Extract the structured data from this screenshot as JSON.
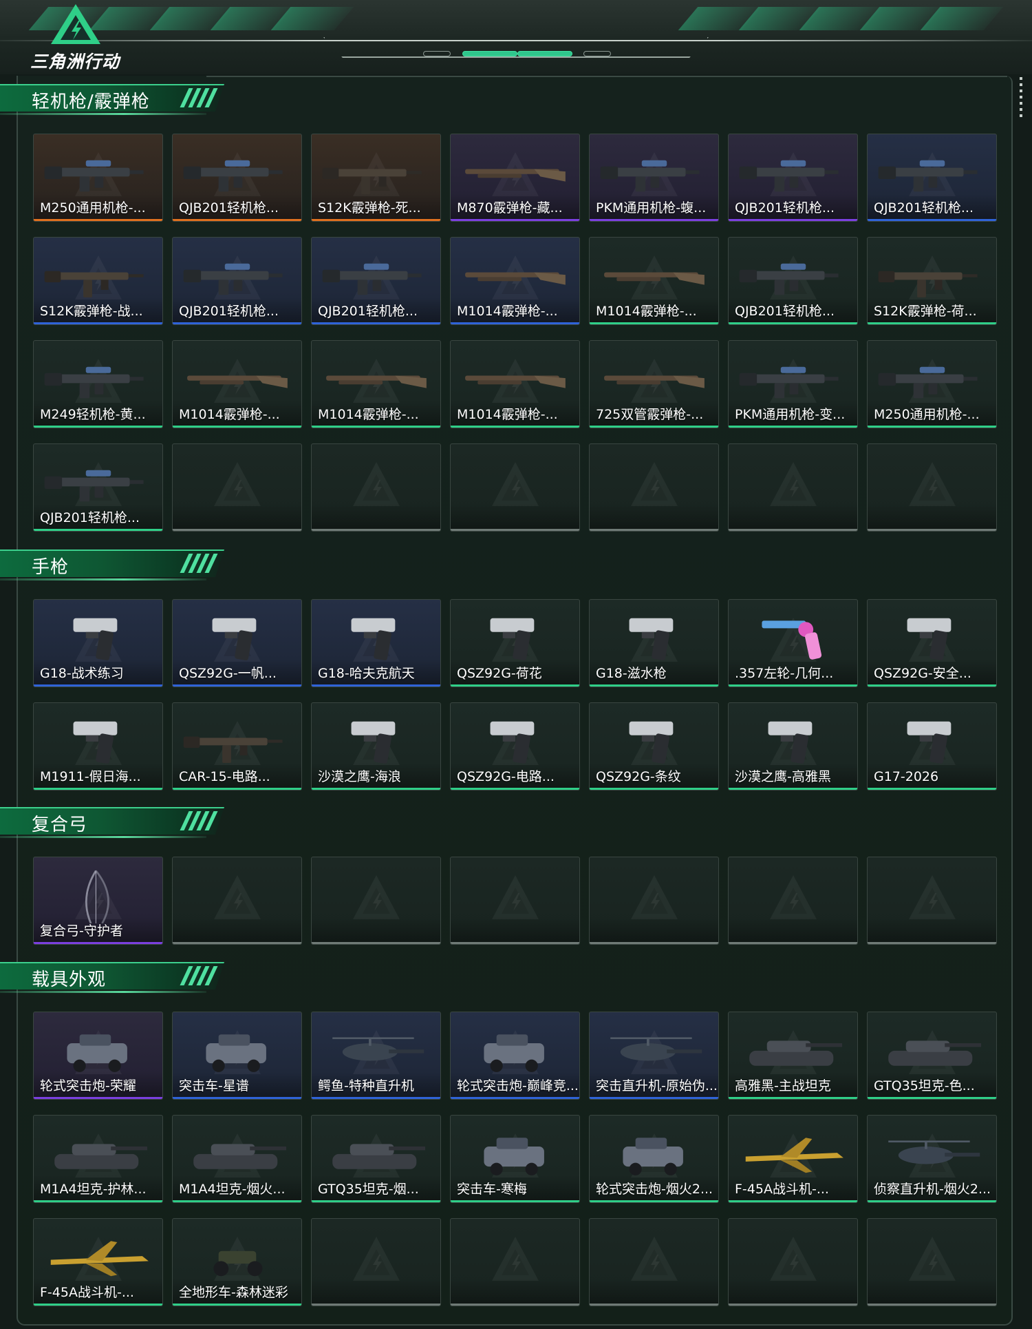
{
  "app": {
    "logo_text": "三角洲行动"
  },
  "colors": {
    "accent": "#2fcf88",
    "orange": "#e0701f",
    "purple": "#7b3fe0",
    "blue": "#2f63d8",
    "green": "#2fcf88",
    "empty": "#6f7a76"
  },
  "sections": [
    {
      "title": "轻机枪/霰弹枪",
      "items": [
        {
          "name": "M250通用机枪-...",
          "rarity": "orange",
          "art": "lmg"
        },
        {
          "name": "QJB201轻机枪...",
          "rarity": "orange",
          "art": "lmg"
        },
        {
          "name": "S12K霰弹枪-死...",
          "rarity": "orange",
          "art": "rifle"
        },
        {
          "name": "M870霰弹枪-藏...",
          "rarity": "purple",
          "art": "shotgun"
        },
        {
          "name": "PKM通用机枪-蝮...",
          "rarity": "purple",
          "art": "lmg"
        },
        {
          "name": "QJB201轻机枪...",
          "rarity": "purple",
          "art": "lmg"
        },
        {
          "name": "QJB201轻机枪...",
          "rarity": "blue",
          "art": "lmg"
        },
        {
          "name": "S12K霰弹枪-战...",
          "rarity": "blue",
          "art": "rifle"
        },
        {
          "name": "QJB201轻机枪...",
          "rarity": "blue",
          "art": "lmg"
        },
        {
          "name": "QJB201轻机枪...",
          "rarity": "blue",
          "art": "lmg"
        },
        {
          "name": "M1014霰弹枪-...",
          "rarity": "blue",
          "art": "shotgun"
        },
        {
          "name": "M1014霰弹枪-...",
          "rarity": "green",
          "art": "shotgun"
        },
        {
          "name": "QJB201轻机枪...",
          "rarity": "green",
          "art": "lmg"
        },
        {
          "name": "S12K霰弹枪-荷...",
          "rarity": "green",
          "art": "rifle"
        },
        {
          "name": "M249轻机枪-黄...",
          "rarity": "green",
          "art": "lmg"
        },
        {
          "name": "M1014霰弹枪-...",
          "rarity": "green",
          "art": "shotgun"
        },
        {
          "name": "M1014霰弹枪-...",
          "rarity": "green",
          "art": "shotgun"
        },
        {
          "name": "M1014霰弹枪-...",
          "rarity": "green",
          "art": "shotgun"
        },
        {
          "name": "725双管霰弹枪-...",
          "rarity": "green",
          "art": "shotgun"
        },
        {
          "name": "PKM通用机枪-变...",
          "rarity": "green",
          "art": "lmg"
        },
        {
          "name": "M250通用机枪-...",
          "rarity": "green",
          "art": "lmg"
        },
        {
          "name": "QJB201轻机枪...",
          "rarity": "green",
          "art": "lmg"
        },
        {
          "name": "",
          "rarity": "empty",
          "art": ""
        },
        {
          "name": "",
          "rarity": "empty",
          "art": ""
        },
        {
          "name": "",
          "rarity": "empty",
          "art": ""
        },
        {
          "name": "",
          "rarity": "empty",
          "art": ""
        },
        {
          "name": "",
          "rarity": "empty",
          "art": ""
        },
        {
          "name": "",
          "rarity": "empty",
          "art": ""
        }
      ]
    },
    {
      "title": "手枪",
      "items": [
        {
          "name": "G18-战术练习",
          "rarity": "blue",
          "art": "pistol"
        },
        {
          "name": "QSZ92G-一帆...",
          "rarity": "blue",
          "art": "pistol"
        },
        {
          "name": "G18-哈夫克航天",
          "rarity": "blue",
          "art": "pistol"
        },
        {
          "name": "QSZ92G-荷花",
          "rarity": "green",
          "art": "pistol"
        },
        {
          "name": "G18-滋水枪",
          "rarity": "green",
          "art": "pistol"
        },
        {
          "name": ".357左轮-几何...",
          "rarity": "green",
          "art": "revolver"
        },
        {
          "name": "QSZ92G-安全...",
          "rarity": "green",
          "art": "pistol"
        },
        {
          "name": "M1911-假日海...",
          "rarity": "green",
          "art": "pistol"
        },
        {
          "name": "CAR-15-电路...",
          "rarity": "green",
          "art": "rifle"
        },
        {
          "name": "沙漠之鹰-海浪",
          "rarity": "green",
          "art": "pistol"
        },
        {
          "name": "QSZ92G-电路...",
          "rarity": "green",
          "art": "pistol"
        },
        {
          "name": "QSZ92G-条纹",
          "rarity": "green",
          "art": "pistol"
        },
        {
          "name": "沙漠之鹰-高雅黑",
          "rarity": "green",
          "art": "pistol"
        },
        {
          "name": "G17-2026",
          "rarity": "green",
          "art": "pistol"
        }
      ]
    },
    {
      "title": "复合弓",
      "items": [
        {
          "name": "复合弓-守护者",
          "rarity": "purple",
          "art": "bow"
        },
        {
          "name": "",
          "rarity": "empty",
          "art": ""
        },
        {
          "name": "",
          "rarity": "empty",
          "art": ""
        },
        {
          "name": "",
          "rarity": "empty",
          "art": ""
        },
        {
          "name": "",
          "rarity": "empty",
          "art": ""
        },
        {
          "name": "",
          "rarity": "empty",
          "art": ""
        },
        {
          "name": "",
          "rarity": "empty",
          "art": ""
        }
      ]
    },
    {
      "title": "载具外观",
      "items": [
        {
          "name": "轮式突击炮-荣耀",
          "rarity": "purple",
          "art": "vehicle"
        },
        {
          "name": "突击车-星谱",
          "rarity": "blue",
          "art": "vehicle"
        },
        {
          "name": "鳄鱼-特种直升机",
          "rarity": "blue",
          "art": "heli"
        },
        {
          "name": "轮式突击炮-巅峰竞...",
          "rarity": "blue",
          "art": "vehicle"
        },
        {
          "name": "突击直升机-原始伪...",
          "rarity": "blue",
          "art": "heli"
        },
        {
          "name": "高雅黑-主战坦克",
          "rarity": "green",
          "art": "tank"
        },
        {
          "name": "GTQ35坦克-色...",
          "rarity": "green",
          "art": "tank"
        },
        {
          "name": "M1A4坦克-护林...",
          "rarity": "green",
          "art": "tank"
        },
        {
          "name": "M1A4坦克-烟火...",
          "rarity": "green",
          "art": "tank"
        },
        {
          "name": "GTQ35坦克-烟...",
          "rarity": "green",
          "art": "tank"
        },
        {
          "name": "突击车-寒梅",
          "rarity": "green",
          "art": "vehicle"
        },
        {
          "name": "轮式突击炮-烟火2...",
          "rarity": "green",
          "art": "vehicle"
        },
        {
          "name": "F-45A战斗机-...",
          "rarity": "green",
          "art": "jet"
        },
        {
          "name": "侦察直升机-烟火2...",
          "rarity": "green",
          "art": "heli"
        },
        {
          "name": "F-45A战斗机-...",
          "rarity": "green",
          "art": "jet"
        },
        {
          "name": "全地形车-森林迷彩",
          "rarity": "green",
          "art": "atv"
        },
        {
          "name": "",
          "rarity": "empty",
          "art": ""
        },
        {
          "name": "",
          "rarity": "empty",
          "art": ""
        },
        {
          "name": "",
          "rarity": "empty",
          "art": ""
        },
        {
          "name": "",
          "rarity": "empty",
          "art": ""
        },
        {
          "name": "",
          "rarity": "empty",
          "art": ""
        }
      ]
    }
  ]
}
